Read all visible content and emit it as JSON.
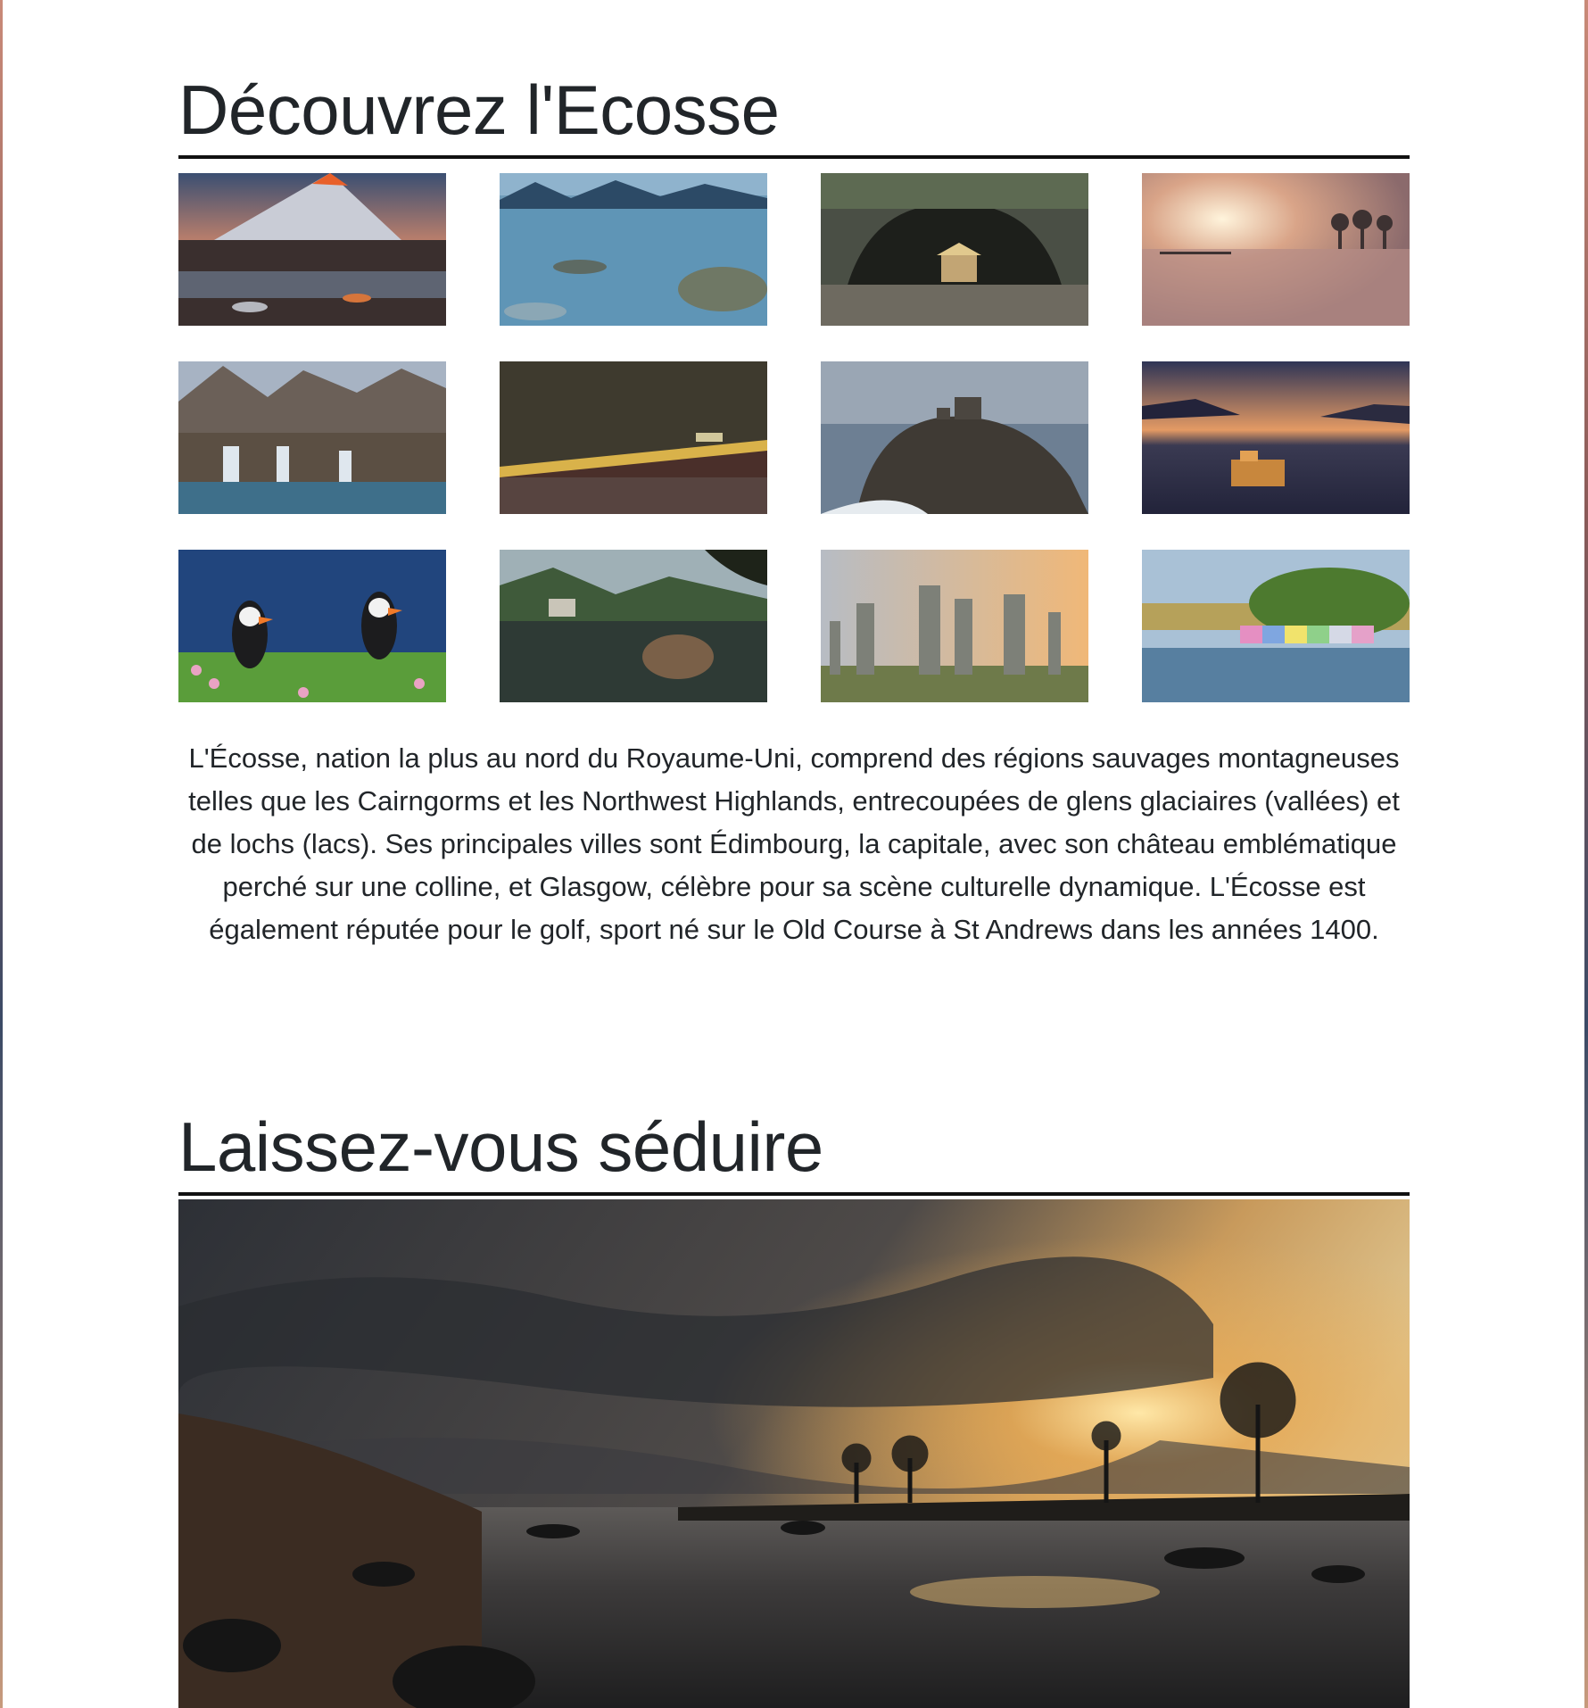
{
  "section_discover": {
    "title": "Découvrez l'Ecosse",
    "gallery": [
      {
        "icon": "mountain-photo-icon"
      },
      {
        "icon": "loch-photo-icon"
      },
      {
        "icon": "cave-photo-icon"
      },
      {
        "icon": "misty-sunrise-photo-icon"
      },
      {
        "icon": "waterfall-photo-icon"
      },
      {
        "icon": "valley-road-photo-icon"
      },
      {
        "icon": "castle-cliff-photo-icon"
      },
      {
        "icon": "castle-lake-photo-icon"
      },
      {
        "icon": "puffins-photo-icon"
      },
      {
        "icon": "loch-ruin-photo-icon"
      },
      {
        "icon": "standing-stones-photo-icon"
      },
      {
        "icon": "harbour-town-photo-icon"
      }
    ],
    "description": "L'Écosse, nation la plus au nord du Royaume-Uni, comprend des régions sauvages montagneuses telles que les Cairngorms et les Northwest Highlands, entrecoupées de glens glaciaires (vallées) et de lochs (lacs). Ses principales villes sont Édimbourg, la capitale, avec son château emblématique perché sur une colline, et Glasgow, célèbre pour sa scène culturelle dynamique. L'Écosse est également réputée pour le golf, sport né sur le Old Course à St Andrews dans les années 1400."
  },
  "section_seduce": {
    "title": "Laissez-vous séduire",
    "hero_icon": "sunset-loch-photo-icon"
  }
}
